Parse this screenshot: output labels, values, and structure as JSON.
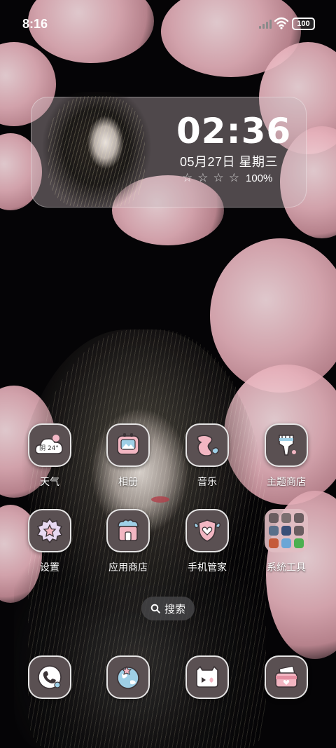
{
  "status_bar": {
    "time": "8:16",
    "battery_level": "100"
  },
  "clock_widget": {
    "time": "02:36",
    "date": "05月27日  星期三",
    "stars": [
      "☆",
      "☆",
      "☆",
      "☆"
    ],
    "battery": "100%"
  },
  "apps": [
    {
      "label": "天气",
      "icon": "weather-icon",
      "icon_text": "阴 24°"
    },
    {
      "label": "相册",
      "icon": "gallery-icon"
    },
    {
      "label": "音乐",
      "icon": "music-icon"
    },
    {
      "label": "主题商店",
      "icon": "theme-store-icon"
    },
    {
      "label": "设置",
      "icon": "settings-icon"
    },
    {
      "label": "应用商店",
      "icon": "app-store-icon"
    },
    {
      "label": "手机管家",
      "icon": "security-icon"
    },
    {
      "label": "系统工具",
      "icon": "system-tools-folder-icon"
    }
  ],
  "search": {
    "label": "搜索"
  },
  "dock": [
    {
      "icon": "phone-icon"
    },
    {
      "icon": "browser-icon"
    },
    {
      "icon": "messages-icon"
    },
    {
      "icon": "wallet-icon"
    }
  ],
  "colors": {
    "tile_background": "#5a5052",
    "tile_border": "#ffffff",
    "blossom_pink": "#e8b3bd",
    "icon_pink": "#f2b6c2",
    "icon_blue": "#9ecfe6"
  }
}
